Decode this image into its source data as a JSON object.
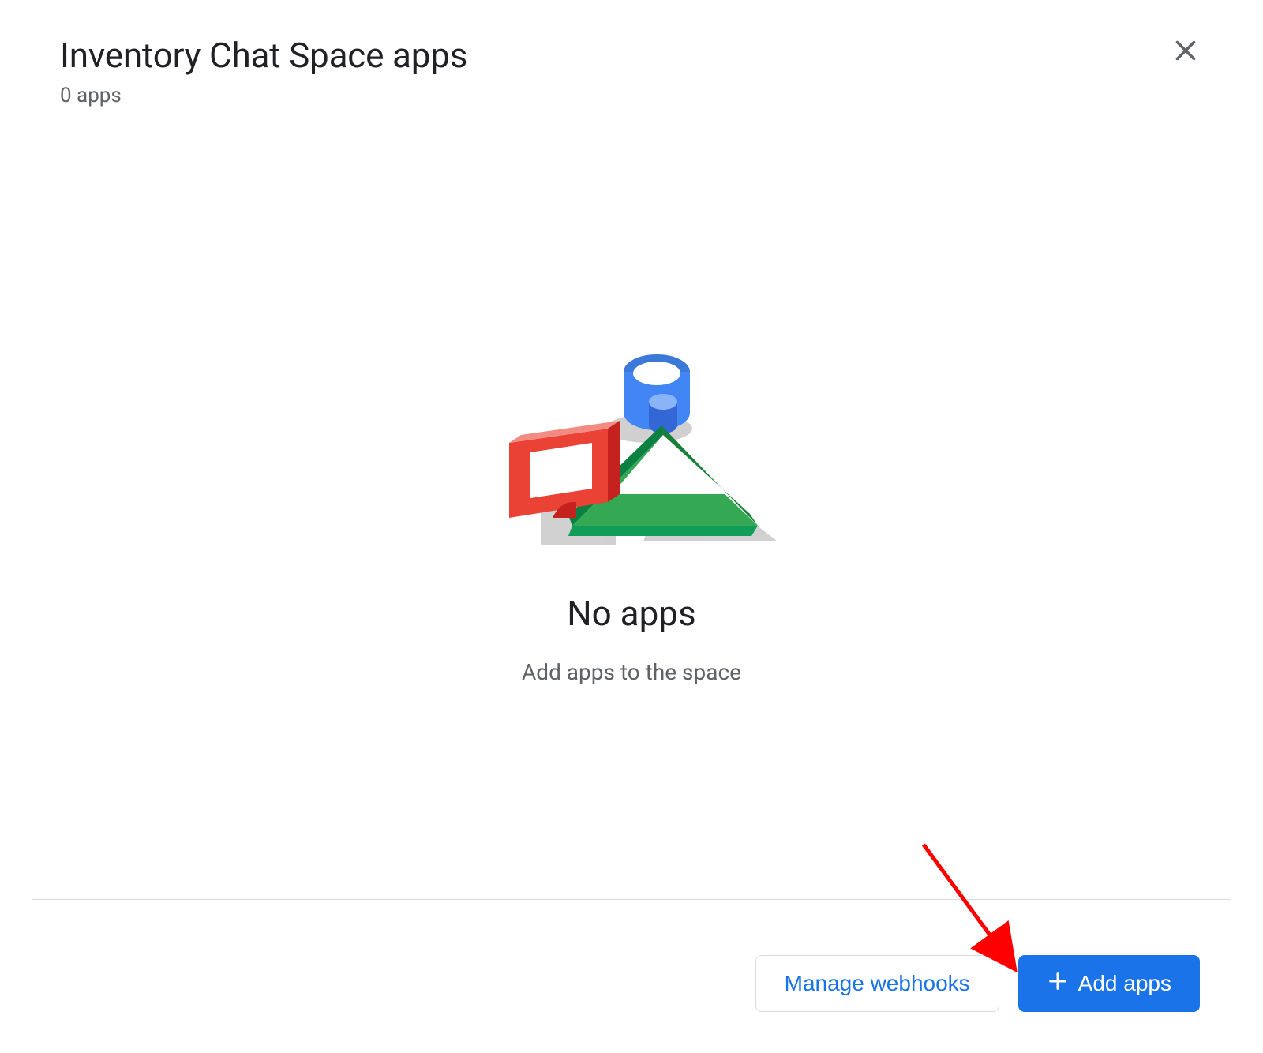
{
  "header": {
    "title": "Inventory Chat Space apps",
    "subtitle": "0 apps"
  },
  "empty": {
    "headline": "No apps",
    "subtext": "Add apps to the space"
  },
  "footer": {
    "manage_label": "Manage webhooks",
    "add_label": "Add apps"
  },
  "colors": {
    "primary": "#1a73e8",
    "text": "#202124",
    "muted": "#5f6368",
    "border": "#dadce0",
    "red": "#ea4335",
    "green": "#0f9d58",
    "blue": "#4285f4"
  }
}
